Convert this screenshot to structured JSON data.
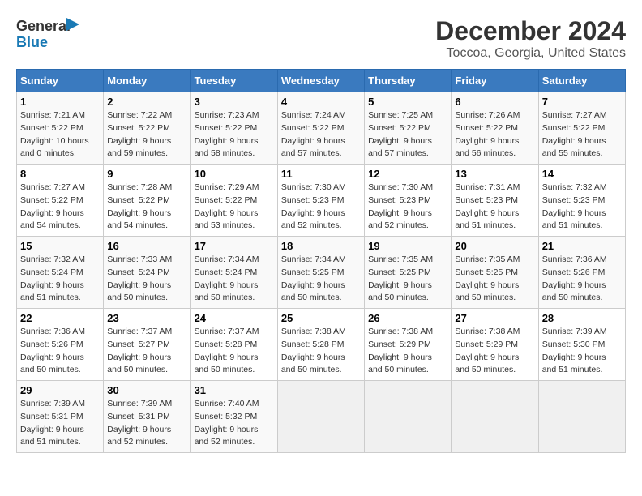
{
  "header": {
    "title": "December 2024",
    "subtitle": "Toccoa, Georgia, United States"
  },
  "logo": {
    "line1": "General",
    "line2": "Blue"
  },
  "days_of_week": [
    "Sunday",
    "Monday",
    "Tuesday",
    "Wednesday",
    "Thursday",
    "Friday",
    "Saturday"
  ],
  "weeks": [
    [
      {
        "day": "1",
        "sunrise": "7:21 AM",
        "sunset": "5:22 PM",
        "daylight": "10 hours and 0 minutes"
      },
      {
        "day": "2",
        "sunrise": "7:22 AM",
        "sunset": "5:22 PM",
        "daylight": "9 hours and 59 minutes"
      },
      {
        "day": "3",
        "sunrise": "7:23 AM",
        "sunset": "5:22 PM",
        "daylight": "9 hours and 58 minutes"
      },
      {
        "day": "4",
        "sunrise": "7:24 AM",
        "sunset": "5:22 PM",
        "daylight": "9 hours and 57 minutes"
      },
      {
        "day": "5",
        "sunrise": "7:25 AM",
        "sunset": "5:22 PM",
        "daylight": "9 hours and 57 minutes"
      },
      {
        "day": "6",
        "sunrise": "7:26 AM",
        "sunset": "5:22 PM",
        "daylight": "9 hours and 56 minutes"
      },
      {
        "day": "7",
        "sunrise": "7:27 AM",
        "sunset": "5:22 PM",
        "daylight": "9 hours and 55 minutes"
      }
    ],
    [
      {
        "day": "8",
        "sunrise": "7:27 AM",
        "sunset": "5:22 PM",
        "daylight": "9 hours and 54 minutes"
      },
      {
        "day": "9",
        "sunrise": "7:28 AM",
        "sunset": "5:22 PM",
        "daylight": "9 hours and 54 minutes"
      },
      {
        "day": "10",
        "sunrise": "7:29 AM",
        "sunset": "5:22 PM",
        "daylight": "9 hours and 53 minutes"
      },
      {
        "day": "11",
        "sunrise": "7:30 AM",
        "sunset": "5:23 PM",
        "daylight": "9 hours and 52 minutes"
      },
      {
        "day": "12",
        "sunrise": "7:30 AM",
        "sunset": "5:23 PM",
        "daylight": "9 hours and 52 minutes"
      },
      {
        "day": "13",
        "sunrise": "7:31 AM",
        "sunset": "5:23 PM",
        "daylight": "9 hours and 51 minutes"
      },
      {
        "day": "14",
        "sunrise": "7:32 AM",
        "sunset": "5:23 PM",
        "daylight": "9 hours and 51 minutes"
      }
    ],
    [
      {
        "day": "15",
        "sunrise": "7:32 AM",
        "sunset": "5:24 PM",
        "daylight": "9 hours and 51 minutes"
      },
      {
        "day": "16",
        "sunrise": "7:33 AM",
        "sunset": "5:24 PM",
        "daylight": "9 hours and 50 minutes"
      },
      {
        "day": "17",
        "sunrise": "7:34 AM",
        "sunset": "5:24 PM",
        "daylight": "9 hours and 50 minutes"
      },
      {
        "day": "18",
        "sunrise": "7:34 AM",
        "sunset": "5:25 PM",
        "daylight": "9 hours and 50 minutes"
      },
      {
        "day": "19",
        "sunrise": "7:35 AM",
        "sunset": "5:25 PM",
        "daylight": "9 hours and 50 minutes"
      },
      {
        "day": "20",
        "sunrise": "7:35 AM",
        "sunset": "5:25 PM",
        "daylight": "9 hours and 50 minutes"
      },
      {
        "day": "21",
        "sunrise": "7:36 AM",
        "sunset": "5:26 PM",
        "daylight": "9 hours and 50 minutes"
      }
    ],
    [
      {
        "day": "22",
        "sunrise": "7:36 AM",
        "sunset": "5:26 PM",
        "daylight": "9 hours and 50 minutes"
      },
      {
        "day": "23",
        "sunrise": "7:37 AM",
        "sunset": "5:27 PM",
        "daylight": "9 hours and 50 minutes"
      },
      {
        "day": "24",
        "sunrise": "7:37 AM",
        "sunset": "5:28 PM",
        "daylight": "9 hours and 50 minutes"
      },
      {
        "day": "25",
        "sunrise": "7:38 AM",
        "sunset": "5:28 PM",
        "daylight": "9 hours and 50 minutes"
      },
      {
        "day": "26",
        "sunrise": "7:38 AM",
        "sunset": "5:29 PM",
        "daylight": "9 hours and 50 minutes"
      },
      {
        "day": "27",
        "sunrise": "7:38 AM",
        "sunset": "5:29 PM",
        "daylight": "9 hours and 50 minutes"
      },
      {
        "day": "28",
        "sunrise": "7:39 AM",
        "sunset": "5:30 PM",
        "daylight": "9 hours and 51 minutes"
      }
    ],
    [
      {
        "day": "29",
        "sunrise": "7:39 AM",
        "sunset": "5:31 PM",
        "daylight": "9 hours and 51 minutes"
      },
      {
        "day": "30",
        "sunrise": "7:39 AM",
        "sunset": "5:31 PM",
        "daylight": "9 hours and 52 minutes"
      },
      {
        "day": "31",
        "sunrise": "7:40 AM",
        "sunset": "5:32 PM",
        "daylight": "9 hours and 52 minutes"
      },
      null,
      null,
      null,
      null
    ]
  ],
  "labels": {
    "sunrise": "Sunrise:",
    "sunset": "Sunset:",
    "daylight": "Daylight:"
  }
}
